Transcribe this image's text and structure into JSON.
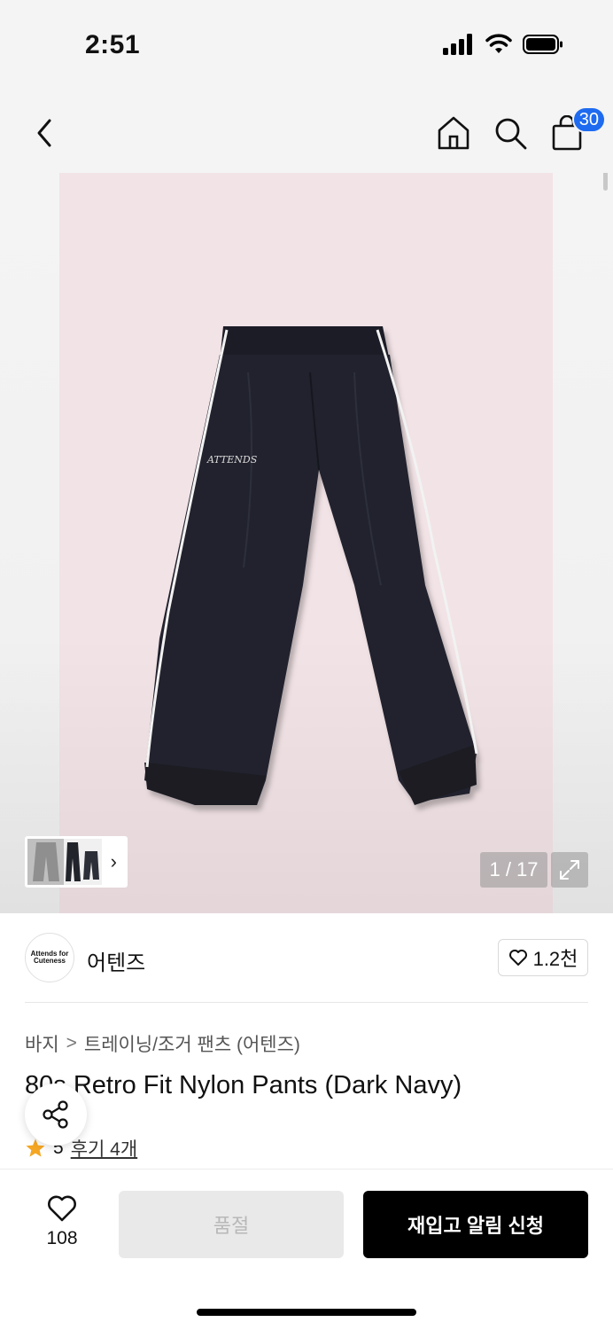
{
  "status_bar": {
    "time": "2:51"
  },
  "header": {
    "cart_count": "30"
  },
  "gallery": {
    "page_counter": "1 / 17"
  },
  "brand": {
    "logo_text": "Attends for Cuteness",
    "name": "어텐즈",
    "likes": "1.2천"
  },
  "breadcrumb": {
    "category": "바지",
    "separator": ">",
    "subcategory": "트레이닝/조거 팬츠 (어텐즈)"
  },
  "product": {
    "title": "80s Retro Fit Nylon Pants (Dark Navy)",
    "rating": "5",
    "review_link": "후기 4개",
    "print_text": "ATTENDS"
  },
  "bottom_bar": {
    "wish_count": "108",
    "sold_out_label": "품절",
    "restock_label": "재입고 알림 신청"
  },
  "colors": {
    "badge": "#1e6bf0",
    "star": "#f5a623",
    "primary_button": "#000000"
  }
}
